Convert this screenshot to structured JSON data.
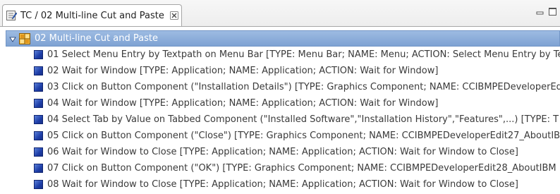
{
  "tab": {
    "title": "TC / 02 Multi-line Cut and Paste",
    "icon": "test-case-editor-icon"
  },
  "view_buttons": {
    "minimize": "minimize-icon",
    "maximize": "maximize-icon"
  },
  "tree": {
    "root": {
      "label": "02 Multi-line Cut and Paste",
      "expanded": true,
      "icon": "test-suite-grid-icon"
    },
    "children": [
      {
        "label": "01 Select Menu Entry by Textpath on Menu Bar [TYPE: Menu Bar; NAME: Menu; ACTION: Select Menu Entry by Te"
      },
      {
        "label": "02 Wait for Window [TYPE: Application; NAME: Application; ACTION: Wait for Window]"
      },
      {
        "label": "03 Click on Button Component (\"Installation Details\") [TYPE: Graphics Component; NAME: CCIBMPEDeveloperEd"
      },
      {
        "label": "04 Wait for Window [TYPE: Application; NAME: Application; ACTION: Wait for Window]"
      },
      {
        "label": "04 Select Tab by Value on Tabbed Component (\"Installed Software\",\"Installation History\",\"Features\",...) [TYPE: T"
      },
      {
        "label": "05 Click on Button Component (\"Close\") [TYPE: Graphics Component; NAME: CCIBMPEDeveloperEdit27_AboutIB"
      },
      {
        "label": "06 Wait for Window to Close [TYPE: Application; NAME: Application; ACTION: Wait for Window to Close]"
      },
      {
        "label": "07 Click on Button Component (\"OK\") [TYPE: Graphics Component; NAME: CCIBMPEDeveloperEdit28_AboutIBM"
      },
      {
        "label": "08 Wait for Window to Close [TYPE: Application; NAME: Application; ACTION: Wait for Window to Close]"
      }
    ]
  }
}
